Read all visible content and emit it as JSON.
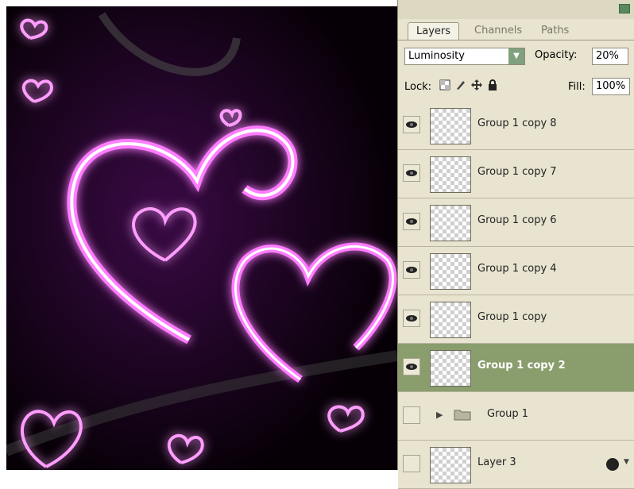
{
  "panel": {
    "tabs": [
      {
        "label": "Layers"
      },
      {
        "label": "Channels"
      },
      {
        "label": "Paths"
      }
    ],
    "blend_mode": "Luminosity",
    "opacity_label": "Opacity:",
    "opacity_value": "20%",
    "lock_label": "Lock:",
    "fill_label": "Fill:",
    "fill_value": "100%"
  },
  "layers": [
    {
      "name": "Group 1 copy 8",
      "visible": true,
      "selected": false
    },
    {
      "name": "Group 1 copy 7",
      "visible": true,
      "selected": false
    },
    {
      "name": "Group 1 copy 6",
      "visible": true,
      "selected": false
    },
    {
      "name": "Group 1 copy 4",
      "visible": true,
      "selected": false
    },
    {
      "name": "Group 1 copy",
      "visible": true,
      "selected": false
    },
    {
      "name": "Group 1 copy 2",
      "visible": true,
      "selected": true
    },
    {
      "name": "Group 1",
      "visible": false,
      "selected": false,
      "type": "group"
    },
    {
      "name": "Layer 3",
      "visible": false,
      "selected": false
    }
  ],
  "colors": {
    "accent_selected": "#8a9d6d",
    "glow": "#ff4dff",
    "artwork_bg": "#060006"
  }
}
